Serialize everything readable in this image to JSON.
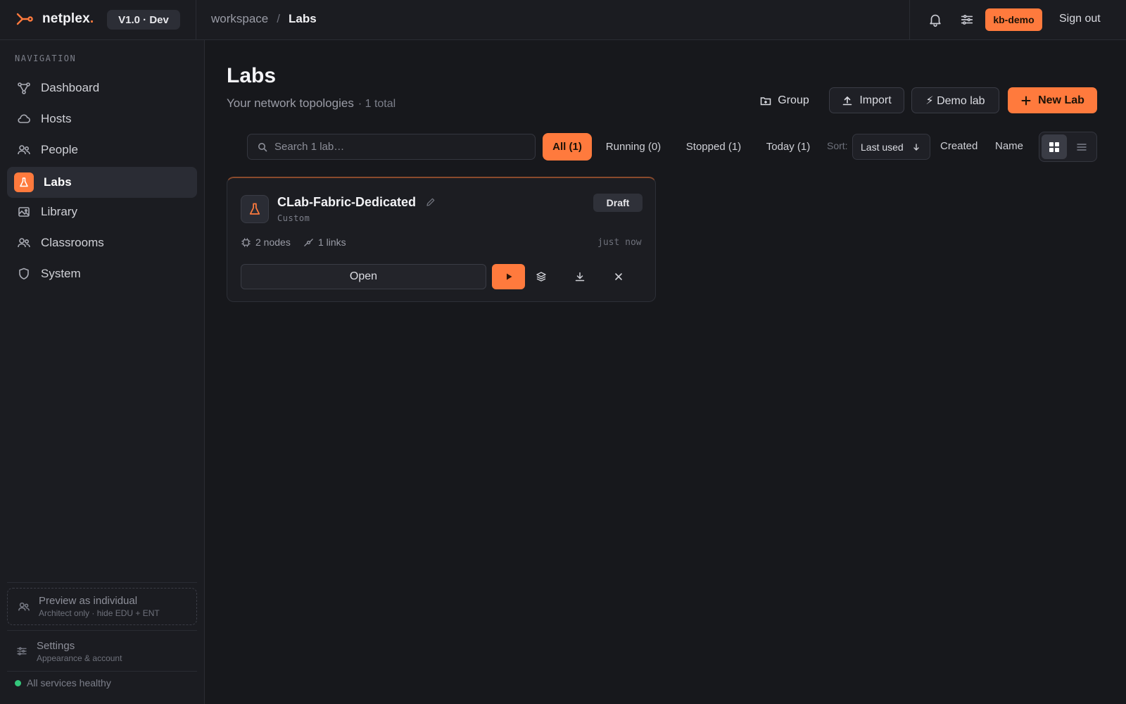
{
  "topbar": {
    "brand": "netplex",
    "brand_dot": ".",
    "version": "V1.0 · Dev",
    "breadcrumb": [
      "workspace",
      "/",
      "Labs"
    ],
    "user": "kb-demo",
    "sign_out": "Sign out",
    "icons": [
      "bell-icon",
      "sliders-icon"
    ]
  },
  "sidebar": {
    "heading": "NAVIGATION",
    "items": [
      {
        "label": "Dashboard",
        "icon": "topology-icon"
      },
      {
        "label": "Hosts",
        "icon": "cloud-icon"
      },
      {
        "label": "People",
        "icon": "users-icon"
      },
      {
        "label": "Labs",
        "icon": "flask-icon",
        "active": true
      },
      {
        "label": "Library",
        "icon": "image-icon"
      },
      {
        "label": "Classrooms",
        "icon": "users-icon"
      },
      {
        "label": "System",
        "icon": "shield-icon"
      }
    ],
    "preview": {
      "title": "Preview as individual",
      "subtitle": "Architect only · hide EDU + ENT"
    },
    "settings": {
      "title": "Settings",
      "subtitle": "Appearance & account"
    },
    "health": "All services healthy"
  },
  "main": {
    "title": "Labs",
    "subtitle": "Your network topologies",
    "count": "· 1 total",
    "actions": {
      "group": "Group",
      "import": "Import",
      "demo": "⚡ Demo lab",
      "new": "New Lab"
    },
    "search_placeholder": "Search 1 lab…",
    "filters": [
      "All (1)",
      "Running (0)",
      "Stopped (1)",
      "Today (1)"
    ],
    "active_filter": "All (1)",
    "sort_label": "Sort:",
    "sort_selected": "Last used",
    "sort_options": [
      "Created",
      "Name"
    ],
    "view_mode": "grid"
  },
  "labs": [
    {
      "name": "CLab-Fabric-Dedicated",
      "type": "Custom",
      "status": "Draft",
      "nodes": "2 nodes",
      "links": "1 links",
      "updated": "just now",
      "open_label": "Open"
    }
  ],
  "colors": {
    "accent": "#ff7a3d",
    "background": "#17181c",
    "surface": "#1b1c21",
    "healthy": "#34c77b"
  }
}
